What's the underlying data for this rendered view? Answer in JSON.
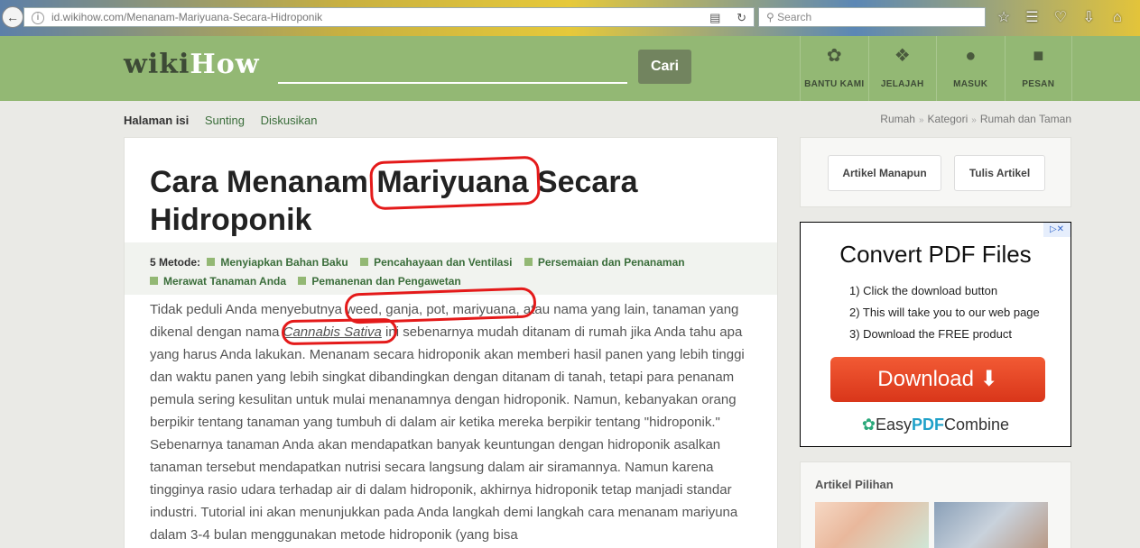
{
  "browser": {
    "url_host": "id.wikihow.com",
    "url_path": "/Menanam-Mariyuana-Secara-Hidroponik",
    "search_placeholder": "Search"
  },
  "header": {
    "logo_wiki": "wiki",
    "logo_how": "How",
    "search_button": "Cari",
    "nav": [
      {
        "label": "BANTU KAMI",
        "icon": "sprout-icon"
      },
      {
        "label": "JELAJAH",
        "icon": "compass-icon"
      },
      {
        "label": "MASUK",
        "icon": "user-icon"
      },
      {
        "label": "PESAN",
        "icon": "chat-icon"
      }
    ]
  },
  "subnav": {
    "tabs": [
      "Halaman isi",
      "Sunting",
      "Diskusikan"
    ],
    "breadcrumb": [
      "Rumah",
      "Kategori",
      "Rumah dan Taman"
    ]
  },
  "article": {
    "title": "Cara Menanam Mariyuana Secara Hidroponik",
    "methods_label": "5 Metode:",
    "methods": [
      "Menyiapkan Bahan Baku",
      "Pencahayaan dan Ventilasi",
      "Persemaian dan Penanaman",
      "Merawat Tanaman Anda",
      "Pemanenan dan Pengawetan"
    ],
    "intro_before_italic": "Tidak peduli Anda menyebutnya weed, ganja, pot, mariyuana, atau nama yang lain, tanaman yang dikenal dengan nama ",
    "intro_italic": "Cannabis Sativa",
    "intro_after_italic": " ini sebenarnya mudah ditanam di rumah jika Anda tahu apa yang harus Anda lakukan. Menanam secara hidroponik akan memberi hasil panen yang lebih tinggi dan waktu panen yang lebih singkat dibandingkan dengan ditanam di tanah, tetapi para penanam pemula sering kesulitan untuk mulai menanamnya dengan hidroponik. Namun, kebanyakan orang berpikir tentang tanaman yang tumbuh di dalam air ketika mereka berpikir tentang \"hidroponik.\" Sebenarnya tanaman Anda akan mendapatkan banyak keuntungan dengan hidroponik asalkan tanaman tersebut mendapatkan nutrisi secara langsung dalam air siramannya. Namun karena tingginya rasio udara terhadap air di dalam hidroponik, akhirnya hidroponik tetap manjadi standar industri. Tutorial ini akan menunjukkan pada Anda langkah demi langkah cara menanam mariyuna dalam 3-4 bulan menggunakan metode hidroponik (yang bisa"
  },
  "sidebar": {
    "btn_random": "Artikel Manapun",
    "btn_write": "Tulis Artikel",
    "ad": {
      "title": "Convert PDF Files",
      "steps": [
        "1) Click the download button",
        "2) This will take you to our web page",
        "3) Download the FREE product"
      ],
      "button": "Download",
      "brand_pre": "Easy",
      "brand_mid": "PDF",
      "brand_post": "Combine"
    },
    "featured_heading": "Artikel Pilihan"
  },
  "colors": {
    "header_green": "#93b874",
    "link_green": "#3a6d3a",
    "annotation_red": "#e41a1a",
    "download_orange": "#e4461f"
  }
}
